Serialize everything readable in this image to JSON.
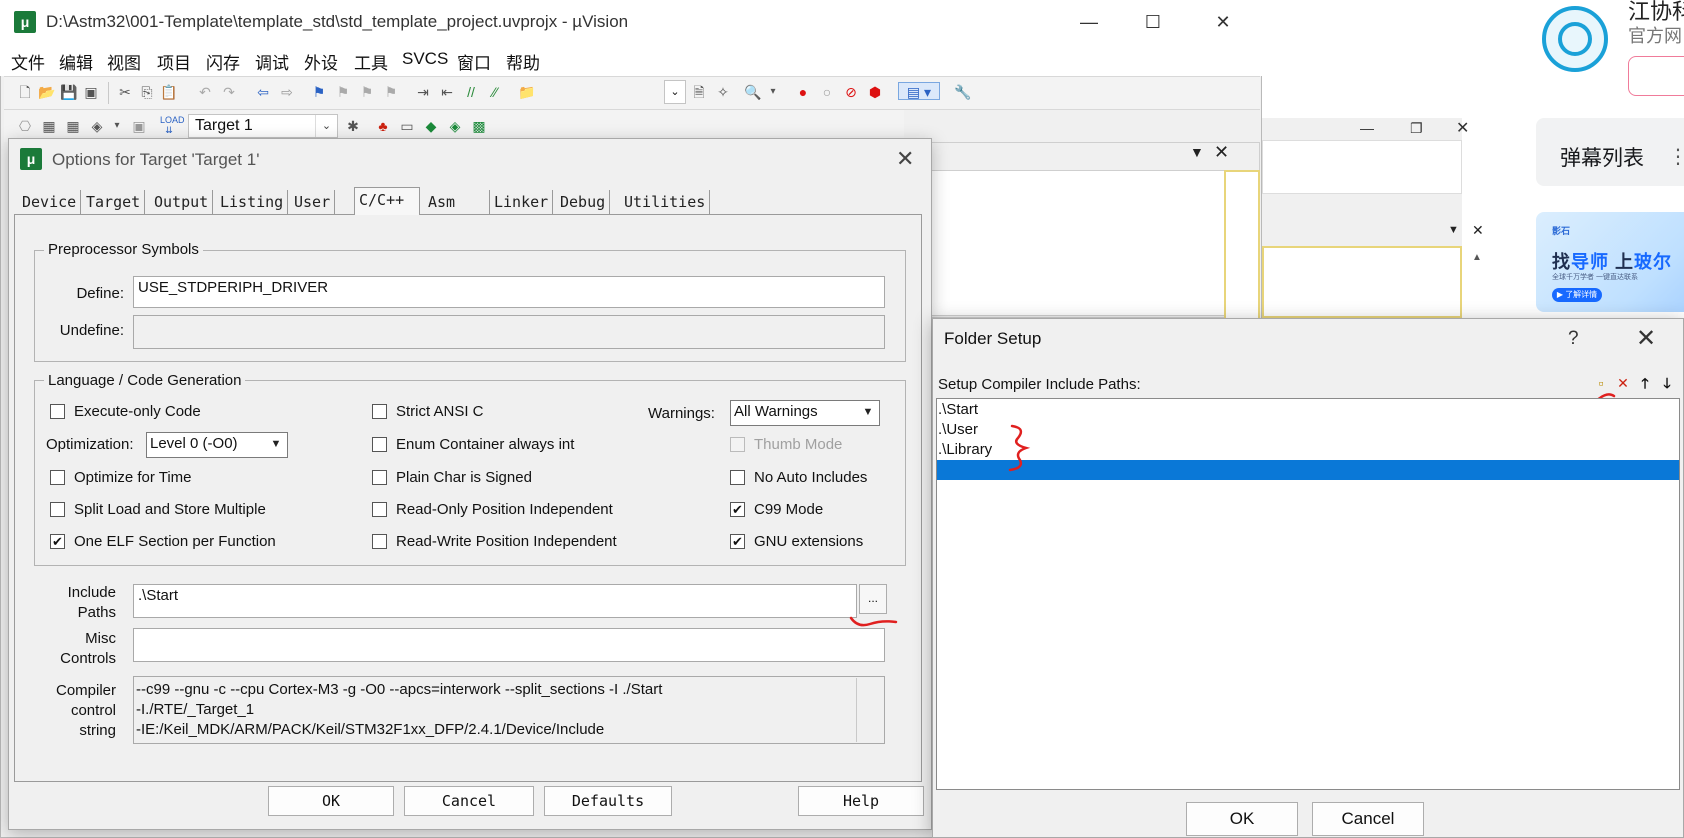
{
  "window": {
    "title": "D:\\Astm32\\001-Template\\template_std\\std_template_project.uvprojx - µVision",
    "minimize": "—",
    "maximize": "☐",
    "close": "✕"
  },
  "menu": [
    "文件",
    "编辑",
    "视图",
    "项目",
    "闪存",
    "调试",
    "外设",
    "工具",
    "SVCS",
    "窗口",
    "帮助"
  ],
  "toolbar": {
    "target": "Target 1"
  },
  "options_dialog": {
    "title": "Options for Target 'Target 1'",
    "tabs": [
      "Device",
      "Target",
      "Output",
      "Listing",
      "User",
      "C/C++",
      "Asm",
      "Linker",
      "Debug",
      "Utilities"
    ],
    "active_tab": "C/C++",
    "preprocessor": {
      "group_label": "Preprocessor Symbols",
      "define_label": "Define:",
      "define_value": "USE_STDPERIPH_DRIVER",
      "undefine_label": "Undefine:",
      "undefine_value": ""
    },
    "language": {
      "group_label": "Language / Code Generation",
      "execute_only": {
        "label": "Execute-only Code",
        "checked": false
      },
      "optimization_label": "Optimization:",
      "optimization_value": "Level 0 (-O0)",
      "optimize_time": {
        "label": "Optimize for Time",
        "checked": false
      },
      "split_load": {
        "label": "Split Load and Store Multiple",
        "checked": false
      },
      "one_elf": {
        "label": "One ELF Section per Function",
        "checked": true
      },
      "strict_ansi": {
        "label": "Strict ANSI C",
        "checked": false
      },
      "enum_container": {
        "label": "Enum Container always int",
        "checked": false
      },
      "plain_char": {
        "label": "Plain Char is Signed",
        "checked": false
      },
      "ro_pos": {
        "label": "Read-Only Position Independent",
        "checked": false
      },
      "rw_pos": {
        "label": "Read-Write Position Independent",
        "checked": false
      },
      "warnings_label": "Warnings:",
      "warnings_value": "All Warnings",
      "thumb_mode": {
        "label": "Thumb Mode",
        "checked": false,
        "disabled": true
      },
      "no_auto_includes": {
        "label": "No Auto Includes",
        "checked": false
      },
      "c99_mode": {
        "label": "C99 Mode",
        "checked": true
      },
      "gnu_ext": {
        "label": "GNU extensions",
        "checked": true
      }
    },
    "include_paths": {
      "label_1": "Include",
      "label_2": "Paths",
      "value": ".\\Start",
      "browse": "..."
    },
    "misc_controls": {
      "label_1": "Misc",
      "label_2": "Controls",
      "value": ""
    },
    "compiler_string": {
      "label_1": "Compiler",
      "label_2": "control",
      "label_3": "string",
      "line1": "--c99 --gnu -c --cpu Cortex-M3 -g -O0 --apcs=interwork --split_sections -I ./Start",
      "line2": "-I./RTE/_Target_1",
      "line3": "-IE:/Keil_MDK/ARM/PACK/Keil/STM32F1xx_DFP/2.4.1/Device/Include"
    },
    "buttons": {
      "ok": "OK",
      "cancel": "Cancel",
      "defaults": "Defaults",
      "help": "Help"
    }
  },
  "folder_dialog": {
    "title": "Folder Setup",
    "help": "?",
    "close": "✕",
    "caption": "Setup Compiler Include Paths:",
    "paths": [
      ".\\Start",
      ".\\User",
      ".\\Library",
      ""
    ],
    "selected_index": 3,
    "buttons": {
      "ok": "OK",
      "cancel": "Cancel"
    },
    "tools": [
      "new-folder-icon",
      "delete-icon",
      "move-up-icon",
      "move-down-icon"
    ]
  },
  "background_page": {
    "site_name": "江协科",
    "site_sub": "官方网",
    "danmu_title": "弹幕列表",
    "danmu_more": "⋮",
    "ad_brand": "影石",
    "ad_main_1": "找",
    "ad_main_2": "导师",
    "ad_main_3": " 上",
    "ad_main_4": "玻尔",
    "ad_small": "全球千万学者  一键直达联系",
    "ad_cta": "▶ 了解详情"
  },
  "colors": {
    "accent_selection": "#0a78d7",
    "annotation": "#e0201f",
    "logo": "#1aa1d8"
  }
}
